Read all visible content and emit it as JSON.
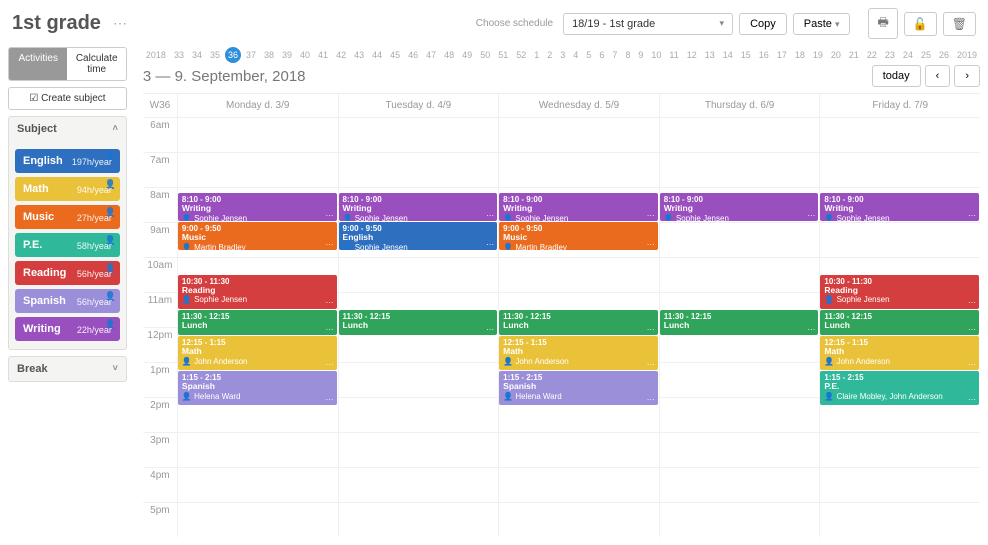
{
  "header": {
    "title": "1st grade",
    "choose_label": "Choose schedule",
    "schedule_value": "18/19 - 1st grade",
    "copy_label": "Copy",
    "paste_label": "Paste"
  },
  "sidebar": {
    "tabs": {
      "activities": "Activities",
      "calculate": "Calculate time"
    },
    "create_subject": "☑ Create subject",
    "subject_panel_title": "Subject",
    "break_panel_title": "Break",
    "subjects": [
      {
        "name": "English",
        "per_year": "197h/year",
        "color": "#2f6fbf"
      },
      {
        "name": "Math",
        "per_year": "94h/year",
        "color": "#e9c23a"
      },
      {
        "name": "Music",
        "per_year": "27h/year",
        "color": "#ea6a1e"
      },
      {
        "name": "P.E.",
        "per_year": "58h/year",
        "color": "#2fb89a"
      },
      {
        "name": "Reading",
        "per_year": "56h/year",
        "color": "#d53e3e"
      },
      {
        "name": "Spanish",
        "per_year": "56h/year",
        "color": "#9a8fd8"
      },
      {
        "name": "Writing",
        "per_year": "22h/year",
        "color": "#9a4fbf"
      }
    ]
  },
  "calendar": {
    "year_start_label": "2018",
    "year_end_label": "2019",
    "week_numbers": [
      "33",
      "34",
      "35",
      "36",
      "37",
      "38",
      "39",
      "40",
      "41",
      "42",
      "43",
      "44",
      "45",
      "46",
      "47",
      "48",
      "49",
      "50",
      "51",
      "52",
      "1",
      "2",
      "3",
      "4",
      "5",
      "6",
      "7",
      "8",
      "9",
      "10",
      "11",
      "12",
      "13",
      "14",
      "15",
      "16",
      "17",
      "18",
      "19",
      "20",
      "21",
      "22",
      "23",
      "24",
      "25",
      "26"
    ],
    "current_week_index": 3,
    "range_title": "3 — 9. September, 2018",
    "today_label": "today",
    "week_col_label": "W36",
    "days": [
      "Monday d. 3/9",
      "Tuesday d. 4/9",
      "Wednesday d. 5/9",
      "Thursday d. 6/9",
      "Friday d. 7/9"
    ],
    "hours": [
      "6am",
      "7am",
      "8am",
      "9am",
      "10am",
      "11am",
      "12pm",
      "1pm",
      "2pm",
      "3pm",
      "4pm",
      "5pm"
    ]
  },
  "colors": {
    "English": "#2f6fbf",
    "Math": "#e9c23a",
    "Music": "#ea6a1e",
    "P.E.": "#2fb89a",
    "Reading": "#d53e3e",
    "Spanish": "#9a8fd8",
    "Writing": "#9a4fbf",
    "Lunch": "#2fa45a"
  },
  "events": [
    {
      "day": 0,
      "time": "8:10 - 9:00",
      "subject": "Writing",
      "teacher": "Sophie Jensen",
      "start_h": 8.17,
      "end_h": 9.0,
      "color": "#9a4fbf"
    },
    {
      "day": 1,
      "time": "8:10 - 9:00",
      "subject": "Writing",
      "teacher": "Sophie Jensen",
      "start_h": 8.17,
      "end_h": 9.0,
      "color": "#9a4fbf"
    },
    {
      "day": 2,
      "time": "8:10 - 9:00",
      "subject": "Writing",
      "teacher": "Sophie Jensen",
      "start_h": 8.17,
      "end_h": 9.0,
      "color": "#9a4fbf"
    },
    {
      "day": 3,
      "time": "8:10 - 9:00",
      "subject": "Writing",
      "teacher": "Sophie Jensen",
      "start_h": 8.17,
      "end_h": 9.0,
      "color": "#9a4fbf"
    },
    {
      "day": 4,
      "time": "8:10 - 9:00",
      "subject": "Writing",
      "teacher": "Sophie Jensen",
      "start_h": 8.17,
      "end_h": 9.0,
      "color": "#9a4fbf"
    },
    {
      "day": 0,
      "time": "9:00 - 9:50",
      "subject": "Music",
      "teacher": "Martin Bradley",
      "start_h": 9.0,
      "end_h": 9.83,
      "color": "#ea6a1e"
    },
    {
      "day": 1,
      "time": "9:00 - 9:50",
      "subject": "English",
      "teacher": "Sophie Jensen",
      "start_h": 9.0,
      "end_h": 9.83,
      "color": "#2f6fbf"
    },
    {
      "day": 2,
      "time": "9:00 - 9:50",
      "subject": "Music",
      "teacher": "Martin Bradley",
      "start_h": 9.0,
      "end_h": 9.83,
      "color": "#ea6a1e"
    },
    {
      "day": 0,
      "time": "10:30 - 11:30",
      "subject": "Reading",
      "teacher": "Sophie Jensen",
      "start_h": 10.5,
      "end_h": 11.5,
      "color": "#d53e3e"
    },
    {
      "day": 4,
      "time": "10:30 - 11:30",
      "subject": "Reading",
      "teacher": "Sophie Jensen",
      "start_h": 10.5,
      "end_h": 11.5,
      "color": "#d53e3e"
    },
    {
      "day": 0,
      "time": "11:30 - 12:15",
      "subject": "Lunch",
      "teacher": "",
      "start_h": 11.5,
      "end_h": 12.25,
      "color": "#2fa45a"
    },
    {
      "day": 1,
      "time": "11:30 - 12:15",
      "subject": "Lunch",
      "teacher": "",
      "start_h": 11.5,
      "end_h": 12.25,
      "color": "#2fa45a"
    },
    {
      "day": 2,
      "time": "11:30 - 12:15",
      "subject": "Lunch",
      "teacher": "",
      "start_h": 11.5,
      "end_h": 12.25,
      "color": "#2fa45a"
    },
    {
      "day": 3,
      "time": "11:30 - 12:15",
      "subject": "Lunch",
      "teacher": "",
      "start_h": 11.5,
      "end_h": 12.25,
      "color": "#2fa45a"
    },
    {
      "day": 4,
      "time": "11:30 - 12:15",
      "subject": "Lunch",
      "teacher": "",
      "start_h": 11.5,
      "end_h": 12.25,
      "color": "#2fa45a"
    },
    {
      "day": 0,
      "time": "12:15 - 1:15",
      "subject": "Math",
      "teacher": "John Anderson",
      "start_h": 12.25,
      "end_h": 13.25,
      "color": "#e9c23a"
    },
    {
      "day": 2,
      "time": "12:15 - 1:15",
      "subject": "Math",
      "teacher": "John Anderson",
      "start_h": 12.25,
      "end_h": 13.25,
      "color": "#e9c23a"
    },
    {
      "day": 4,
      "time": "12:15 - 1:15",
      "subject": "Math",
      "teacher": "John Anderson",
      "start_h": 12.25,
      "end_h": 13.25,
      "color": "#e9c23a"
    },
    {
      "day": 0,
      "time": "1:15 - 2:15",
      "subject": "Spanish",
      "teacher": "Helena Ward",
      "start_h": 13.25,
      "end_h": 14.25,
      "color": "#9a8fd8"
    },
    {
      "day": 2,
      "time": "1:15 - 2:15",
      "subject": "Spanish",
      "teacher": "Helena Ward",
      "start_h": 13.25,
      "end_h": 14.25,
      "color": "#9a8fd8"
    },
    {
      "day": 4,
      "time": "1:15 - 2:15",
      "subject": "P.E.",
      "teacher": "Claire Mobley, John Anderson",
      "start_h": 13.25,
      "end_h": 14.25,
      "color": "#2fb89a"
    }
  ]
}
